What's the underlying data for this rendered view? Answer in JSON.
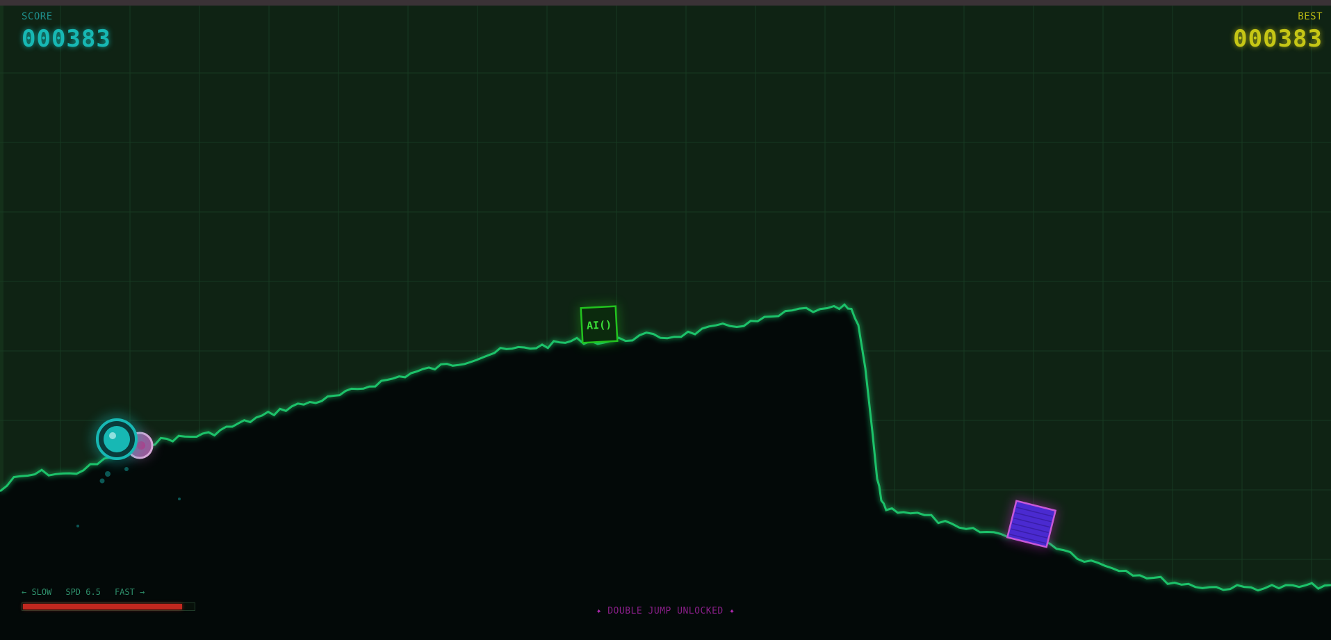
{
  "hud": {
    "score_label": "SCORE",
    "score_value": "000383",
    "best_label": "BEST",
    "best_value": "000383"
  },
  "speed": {
    "slow_label": "← SLOW",
    "speed_text": "SPD 6.5",
    "fast_label": "FAST →",
    "fill_fraction": 0.93
  },
  "status": {
    "star_left": "✦",
    "message": "DOUBLE JUMP UNLOCKED",
    "star_right": "✦"
  },
  "powerup": {
    "label": "AI()"
  },
  "colors": {
    "terrain_line": "#1fc26a",
    "terrain_fill": "#030908",
    "sky": "#0f2314",
    "player": "#17b8b4",
    "companion": "#b46ab4",
    "obstacle": "#5a2ed0",
    "obstacle_glow": "#d02ad0",
    "powerup": "#22c21e",
    "score": "#17b8b4",
    "best": "#c6c615"
  }
}
